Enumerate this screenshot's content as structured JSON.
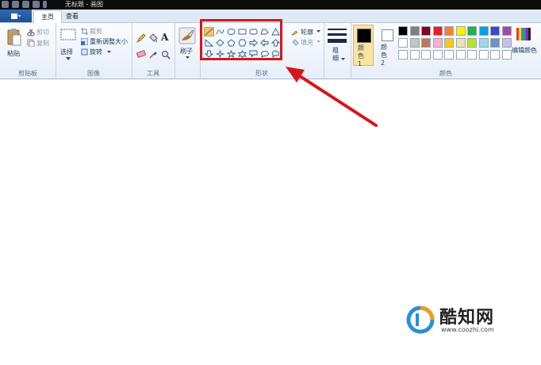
{
  "window": {
    "title": "无标题 - 画图"
  },
  "tabs": [
    {
      "label": "主页"
    },
    {
      "label": "查看"
    }
  ],
  "groups": {
    "clipboard": {
      "label": "剪贴板",
      "paste": "粘贴",
      "cut": "剪切",
      "copy": "复制"
    },
    "image": {
      "label": "图像",
      "select": "选择",
      "crop": "裁剪",
      "resize": "重新调整大小",
      "rotate": "旋转"
    },
    "tools": {
      "label": "工具"
    },
    "brushes": {
      "label": "刷子"
    },
    "shapes": {
      "label": "形状",
      "outline": "轮廓",
      "fill": "填充"
    },
    "size": {
      "label": "粗细"
    },
    "colors": {
      "label": "颜色",
      "color1": "颜色 1",
      "color2": "颜色 2",
      "edit": "编辑颜色",
      "palette_row1": [
        "#000000",
        "#7f7f7f",
        "#880015",
        "#ed1c24",
        "#ff7f27",
        "#fff200",
        "#22b14c",
        "#00a2e8",
        "#3f48cc",
        "#a349a4"
      ],
      "palette_row2": [
        "#ffffff",
        "#c3c3c3",
        "#b97a57",
        "#ffaec9",
        "#ffc90e",
        "#efe4b0",
        "#b5e61d",
        "#99d9ea",
        "#7092be",
        "#c8bfe7"
      ],
      "color1_value": "#000000",
      "color2_value": "#ffffff"
    }
  },
  "watermark": {
    "brand": "酷知网",
    "url": "www.coozhi.com"
  },
  "accent": "#d6161c"
}
